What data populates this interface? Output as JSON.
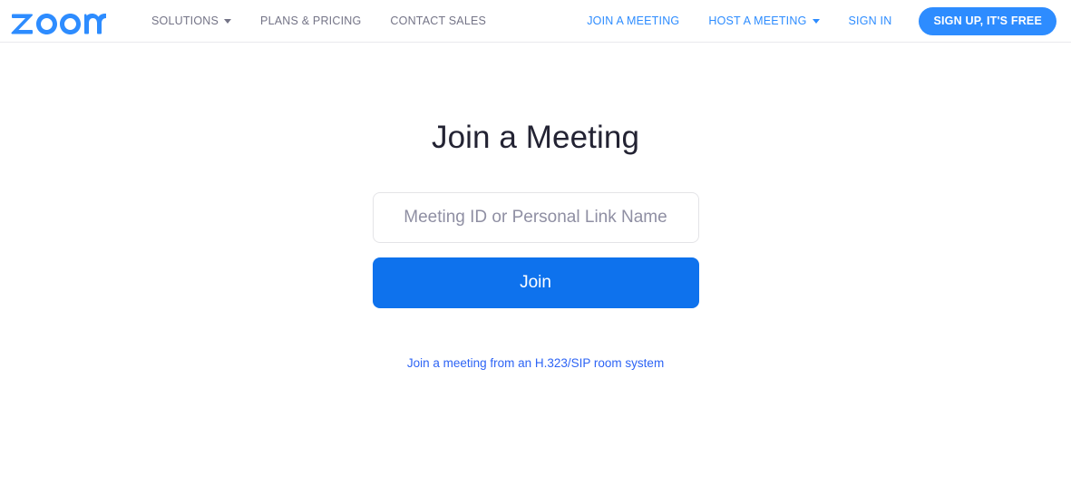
{
  "header": {
    "logo_text": "zoom",
    "logo_color": "#2D8CFF",
    "nav_left": [
      {
        "label": "SOLUTIONS",
        "has_caret": true
      },
      {
        "label": "PLANS & PRICING",
        "has_caret": false
      },
      {
        "label": "CONTACT SALES",
        "has_caret": false
      }
    ],
    "nav_right": [
      {
        "label": "JOIN A MEETING",
        "has_caret": false
      },
      {
        "label": "HOST A MEETING",
        "has_caret": true
      },
      {
        "label": "SIGN IN",
        "has_caret": false
      }
    ],
    "signup_label": "SIGN UP, IT'S FREE"
  },
  "main": {
    "title": "Join a Meeting",
    "meeting_input": {
      "placeholder": "Meeting ID or Personal Link Name",
      "value": ""
    },
    "join_label": "Join",
    "sip_link_label": "Join a meeting from an H.323/SIP room system"
  },
  "colors": {
    "brand_blue": "#2D8CFF",
    "button_blue": "#0E72ED",
    "link_blue": "#2D64F5",
    "nav_grey": "#747487",
    "heading": "#232333"
  }
}
